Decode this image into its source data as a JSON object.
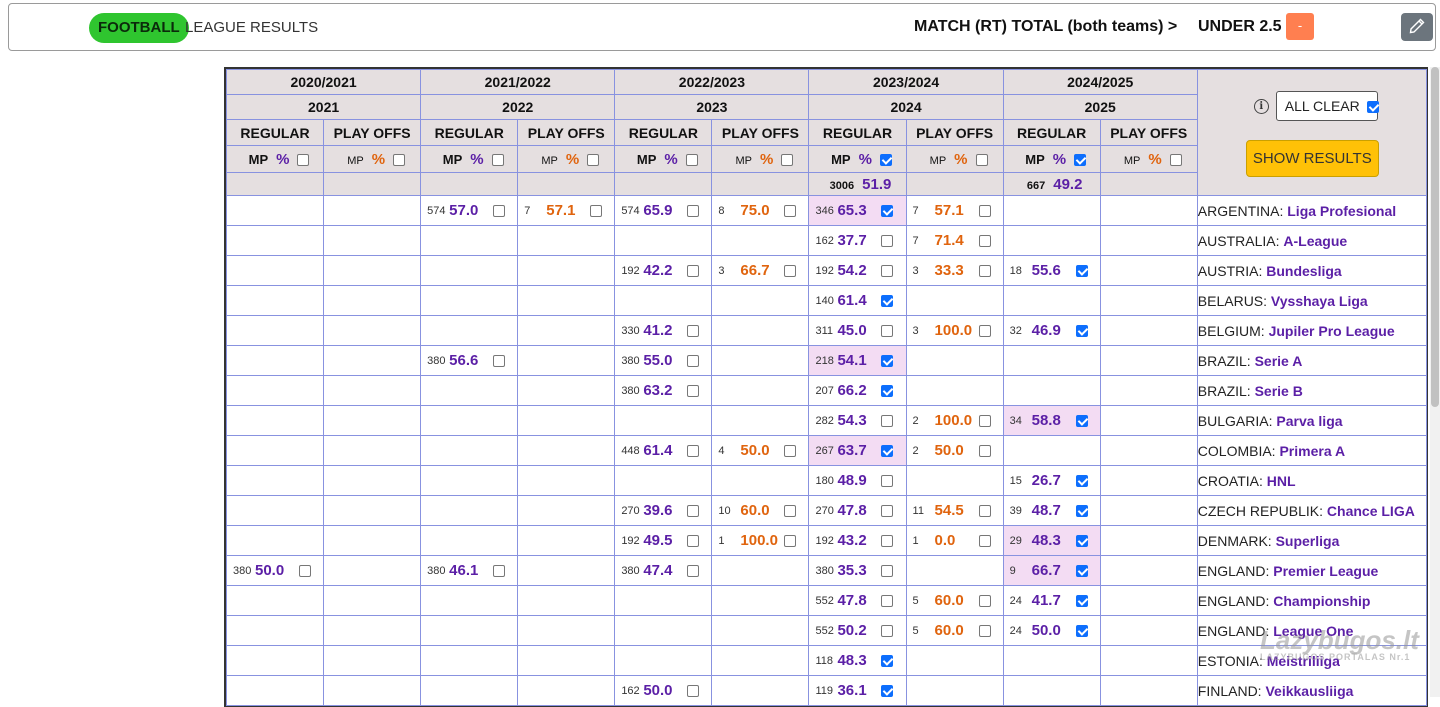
{
  "header": {
    "sport": "FOOTBALL",
    "title": "LEAGUE RESULTS",
    "market": "MATCH (RT) TOTAL (both teams) >",
    "selection": "UNDER 2.5",
    "minus": "-",
    "edit_icon": "pencil-icon"
  },
  "seasons": [
    {
      "season": "2020/2021",
      "year": "2021",
      "reg_checked": false,
      "po_checked": false,
      "total_mp": "",
      "total_pct": ""
    },
    {
      "season": "2021/2022",
      "year": "2022",
      "reg_checked": false,
      "po_checked": false,
      "total_mp": "",
      "total_pct": ""
    },
    {
      "season": "2022/2023",
      "year": "2023",
      "reg_checked": false,
      "po_checked": false,
      "total_mp": "",
      "total_pct": ""
    },
    {
      "season": "2023/2024",
      "year": "2024",
      "reg_checked": true,
      "po_checked": false,
      "total_mp": "3006",
      "total_pct": "51.9"
    },
    {
      "season": "2024/2025",
      "year": "2025",
      "reg_checked": true,
      "po_checked": false,
      "total_mp": "667",
      "total_pct": "49.2"
    }
  ],
  "labels": {
    "regular": "REGULAR",
    "playoffs": "PLAY OFFS",
    "mp": "MP",
    "pct": "%",
    "all_clear": "ALL CLEAR",
    "show_results": "SHOW RESULTS",
    "info_icon": "info-icon"
  },
  "rows": [
    {
      "country": "ARGENTINA",
      "league": "Liga Profesional",
      "cells": [
        null,
        null,
        [
          "574",
          "57.0",
          false
        ],
        [
          "7",
          "57.1",
          false
        ],
        [
          "574",
          "65.9",
          false
        ],
        [
          "8",
          "75.0",
          false
        ],
        [
          "346",
          "65.3",
          true,
          true
        ],
        [
          "7",
          "57.1",
          false
        ],
        null,
        null
      ]
    },
    {
      "country": "AUSTRALIA",
      "league": "A-League",
      "cells": [
        null,
        null,
        null,
        null,
        null,
        null,
        [
          "162",
          "37.7",
          false
        ],
        [
          "7",
          "71.4",
          false
        ],
        null,
        null
      ]
    },
    {
      "country": "AUSTRIA",
      "league": "Bundesliga",
      "cells": [
        null,
        null,
        null,
        null,
        [
          "192",
          "42.2",
          false
        ],
        [
          "3",
          "66.7",
          false
        ],
        [
          "192",
          "54.2",
          false
        ],
        [
          "3",
          "33.3",
          false
        ],
        [
          "18",
          "55.6",
          true
        ],
        null
      ]
    },
    {
      "country": "BELARUS",
      "league": "Vysshaya Liga",
      "cells": [
        null,
        null,
        null,
        null,
        null,
        null,
        [
          "140",
          "61.4",
          true
        ],
        null,
        null,
        null
      ]
    },
    {
      "country": "BELGIUM",
      "league": "Jupiler Pro League",
      "cells": [
        null,
        null,
        null,
        null,
        [
          "330",
          "41.2",
          false
        ],
        null,
        [
          "311",
          "45.0",
          false
        ],
        [
          "3",
          "100.0",
          false
        ],
        [
          "32",
          "46.9",
          true
        ],
        null
      ]
    },
    {
      "country": "BRAZIL",
      "league": "Serie A",
      "cells": [
        null,
        null,
        [
          "380",
          "56.6",
          false
        ],
        null,
        [
          "380",
          "55.0",
          false
        ],
        null,
        [
          "218",
          "54.1",
          true,
          true
        ],
        null,
        null,
        null
      ]
    },
    {
      "country": "BRAZIL",
      "league": "Serie B",
      "cells": [
        null,
        null,
        null,
        null,
        [
          "380",
          "63.2",
          false
        ],
        null,
        [
          "207",
          "66.2",
          true
        ],
        null,
        null,
        null
      ]
    },
    {
      "country": "BULGARIA",
      "league": "Parva liga",
      "cells": [
        null,
        null,
        null,
        null,
        null,
        null,
        [
          "282",
          "54.3",
          false
        ],
        [
          "2",
          "100.0",
          false
        ],
        [
          "34",
          "58.8",
          true,
          true
        ],
        null
      ]
    },
    {
      "country": "COLOMBIA",
      "league": "Primera A",
      "cells": [
        null,
        null,
        null,
        null,
        [
          "448",
          "61.4",
          false
        ],
        [
          "4",
          "50.0",
          false
        ],
        [
          "267",
          "63.7",
          true,
          true
        ],
        [
          "2",
          "50.0",
          false
        ],
        null,
        null
      ]
    },
    {
      "country": "CROATIA",
      "league": "HNL",
      "cells": [
        null,
        null,
        null,
        null,
        null,
        null,
        [
          "180",
          "48.9",
          false
        ],
        null,
        [
          "15",
          "26.7",
          true
        ],
        null
      ]
    },
    {
      "country": "CZECH REPUBLIK",
      "league": "Chance LIGA",
      "cells": [
        null,
        null,
        null,
        null,
        [
          "270",
          "39.6",
          false
        ],
        [
          "10",
          "60.0",
          false
        ],
        [
          "270",
          "47.8",
          false
        ],
        [
          "11",
          "54.5",
          false
        ],
        [
          "39",
          "48.7",
          true
        ],
        null
      ]
    },
    {
      "country": "DENMARK",
      "league": "Superliga",
      "cells": [
        null,
        null,
        null,
        null,
        [
          "192",
          "49.5",
          false
        ],
        [
          "1",
          "100.0",
          false
        ],
        [
          "192",
          "43.2",
          false
        ],
        [
          "1",
          "0.0",
          false
        ],
        [
          "29",
          "48.3",
          true,
          true
        ],
        null
      ]
    },
    {
      "country": "ENGLAND",
      "league": "Premier League",
      "cells": [
        [
          "380",
          "50.0",
          false
        ],
        null,
        [
          "380",
          "46.1",
          false
        ],
        null,
        [
          "380",
          "47.4",
          false
        ],
        null,
        [
          "380",
          "35.3",
          false
        ],
        null,
        [
          "9",
          "66.7",
          true,
          true
        ],
        null
      ]
    },
    {
      "country": "ENGLAND",
      "league": "Championship",
      "cells": [
        null,
        null,
        null,
        null,
        null,
        null,
        [
          "552",
          "47.8",
          false
        ],
        [
          "5",
          "60.0",
          false
        ],
        [
          "24",
          "41.7",
          true
        ],
        null
      ]
    },
    {
      "country": "ENGLAND",
      "league": "League One",
      "cells": [
        null,
        null,
        null,
        null,
        null,
        null,
        [
          "552",
          "50.2",
          false
        ],
        [
          "5",
          "60.0",
          false
        ],
        [
          "24",
          "50.0",
          true
        ],
        null
      ]
    },
    {
      "country": "ESTONIA",
      "league": "Meistriliiga",
      "cells": [
        null,
        null,
        null,
        null,
        null,
        null,
        [
          "118",
          "48.3",
          true
        ],
        null,
        null,
        null
      ]
    },
    {
      "country": "FINLAND",
      "league": "Veikkausliiga",
      "cells": [
        null,
        null,
        null,
        null,
        [
          "162",
          "50.0",
          false
        ],
        null,
        [
          "119",
          "36.1",
          true
        ],
        null,
        null,
        null
      ]
    }
  ],
  "watermark": {
    "text": "Lazybugos.lt",
    "sub": "LAZYBUGOS PORTALAS Nr.1"
  }
}
